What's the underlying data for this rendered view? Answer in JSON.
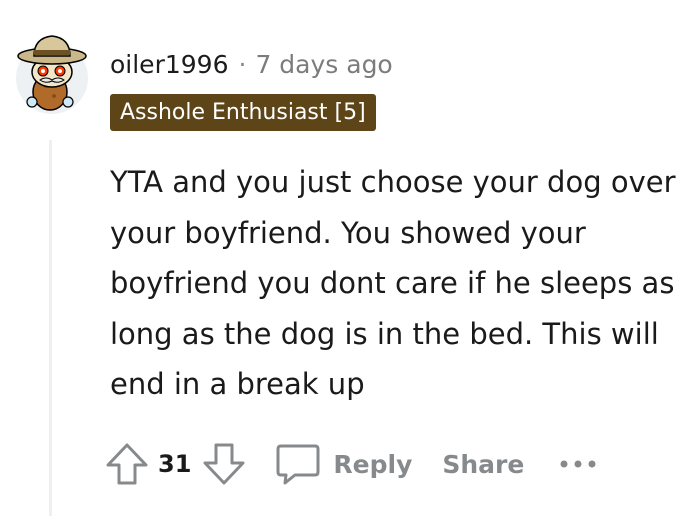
{
  "comment": {
    "username": "oiler1996",
    "separator": "·",
    "timestamp": "7 days ago",
    "flair": "Asshole Enthusiast [5]",
    "body": "YTA and you just choose your dog over your boyfriend. You showed your boyfriend you dont care if he sleeps as long as the dog is in the bed. This will end in a break up",
    "vote_count": "31",
    "reply_label": "Reply",
    "share_label": "Share",
    "more_label": "•••"
  },
  "icons": {
    "avatar": "snoo-avatar-explorer",
    "upvote": "upvote-arrow-icon",
    "downvote": "downvote-arrow-icon",
    "reply": "speech-bubble-icon",
    "more": "more-options-icon"
  },
  "colors": {
    "flair_background": "#5d4518",
    "flair_text": "#ffffff",
    "meta_text": "#7c7c7c",
    "action_text": "#878a8c",
    "thread_line": "#edeff1"
  }
}
